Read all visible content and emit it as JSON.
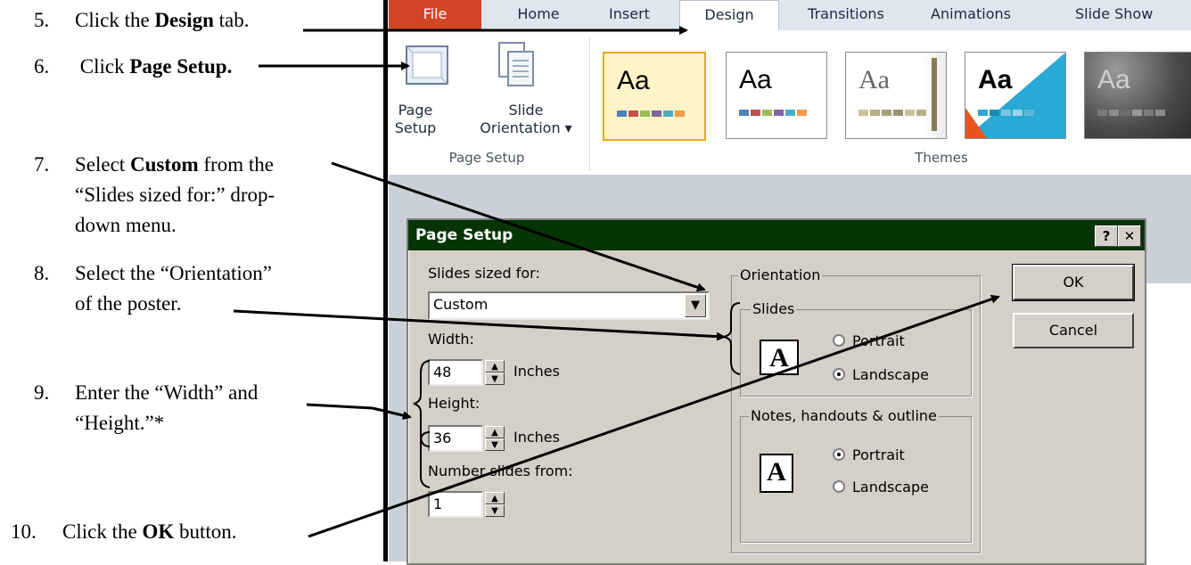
{
  "instructions": {
    "step5": {
      "num": "5.",
      "pre": "Click the ",
      "bold": "Design",
      "post": " tab."
    },
    "step6": {
      "num": "6.",
      "pre": " Click ",
      "bold": "Page Setup."
    },
    "step7": {
      "num": "7.",
      "pre": "Select ",
      "bold": "Custom",
      "post": " from the",
      "line2": "“Slides sized for:” drop-",
      "line3": "down menu."
    },
    "step8": {
      "num": "8.",
      "line1": "Select the “Orientation”",
      "line2": "of the poster."
    },
    "step9": {
      "num": "9.",
      "line1": "Enter the “Width” and",
      "line2": "“Height.”*"
    },
    "step10": {
      "num": "10.",
      "pre": "Click the ",
      "bold": "OK",
      "post": " button."
    }
  },
  "ribbon": {
    "tabs": [
      "File",
      "Home",
      "Insert",
      "Design",
      "Transitions",
      "Animations",
      "Slide Show"
    ],
    "page_setup_label_1": "Page",
    "page_setup_label_2": "Setup",
    "slide_orientation_label_1": "Slide",
    "slide_orientation_label_2": "Orientation ▾",
    "group_page_setup": "Page Setup",
    "group_themes": "Themes",
    "theme_sample": "Aa"
  },
  "dialog": {
    "title": "Page Setup",
    "help_btn": "?",
    "close_btn": "✕",
    "slides_sized_for_label": "Slides sized for:",
    "slides_sized_for_value": "Custom",
    "width_label": "Width:",
    "width_value": "48",
    "width_unit": "Inches",
    "height_label": "Height:",
    "height_value": "36",
    "height_unit": "Inches",
    "number_slides_label": "Number slides from:",
    "number_slides_value": "1",
    "orientation_label": "Orientation",
    "slides_label": "Slides",
    "slides_portrait": "Portrait",
    "slides_landscape": "Landscape",
    "notes_label": "Notes, handouts & outline",
    "notes_portrait": "Portrait",
    "notes_landscape": "Landscape",
    "ok": "OK",
    "cancel": "Cancel"
  },
  "colors": {
    "title_bar": "#053505",
    "file_tab": "#d24625",
    "selected_theme_border": "#e9a825"
  }
}
